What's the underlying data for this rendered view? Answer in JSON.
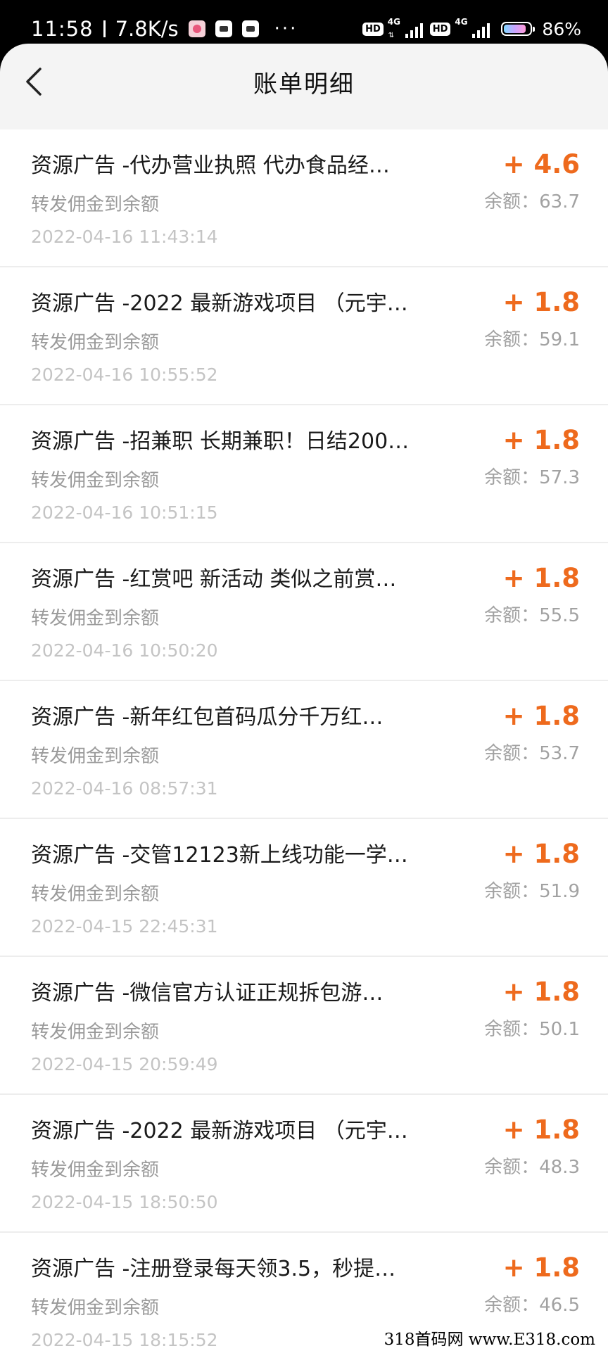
{
  "status_bar": {
    "time": "11:58",
    "speed": "7.8K/s",
    "more": "···",
    "hd_label": "HD",
    "net_label": "4G",
    "battery_level": 0.86,
    "battery_percent": "86%"
  },
  "header": {
    "title": "账单明细"
  },
  "transactions": [
    {
      "title": "资源广告 -代办营业执照 代办食品经…",
      "desc": "转发佣金到余额",
      "date": "2022-04-16 11:43:14",
      "amount": "+ 4.6",
      "balance": "余额：63.7"
    },
    {
      "title": "资源广告 -2022 最新游戏项目 （元宇…",
      "desc": "转发佣金到余额",
      "date": "2022-04-16 10:55:52",
      "amount": "+ 1.8",
      "balance": "余额：59.1"
    },
    {
      "title": "资源广告 -招兼职 长期兼职！日结200…",
      "desc": "转发佣金到余额",
      "date": "2022-04-16 10:51:15",
      "amount": "+ 1.8",
      "balance": "余额：57.3"
    },
    {
      "title": "资源广告 -红赏吧 新活动 类似之前赏…",
      "desc": "转发佣金到余额",
      "date": "2022-04-16 10:50:20",
      "amount": "+ 1.8",
      "balance": "余额：55.5"
    },
    {
      "title": "资源广告 -新年红包首码瓜分千万红…",
      "desc": "转发佣金到余额",
      "date": "2022-04-16 08:57:31",
      "amount": "+ 1.8",
      "balance": "余额：53.7"
    },
    {
      "title": "资源广告 -交管12123新上线功能一学…",
      "desc": "转发佣金到余额",
      "date": "2022-04-15 22:45:31",
      "amount": "+ 1.8",
      "balance": "余额：51.9"
    },
    {
      "title": "资源广告 -微信官方认证正规拆包游…",
      "desc": "转发佣金到余额",
      "date": "2022-04-15 20:59:49",
      "amount": "+ 1.8",
      "balance": "余额：50.1"
    },
    {
      "title": "资源广告 -2022 最新游戏项目 （元宇…",
      "desc": "转发佣金到余额",
      "date": "2022-04-15 18:50:50",
      "amount": "+ 1.8",
      "balance": "余额：48.3"
    },
    {
      "title": "资源广告 -注册登录每天领3.5，秒提…",
      "desc": "转发佣金到余额",
      "date": "2022-04-15 18:15:52",
      "amount": "+ 1.8",
      "balance": "余额：46.5"
    }
  ],
  "watermark": "318首码网  www.E318.com",
  "colors": {
    "accent_amount": "#ee6a1d",
    "page_background": "#f4f4f4",
    "card_background": "#ffffff"
  }
}
